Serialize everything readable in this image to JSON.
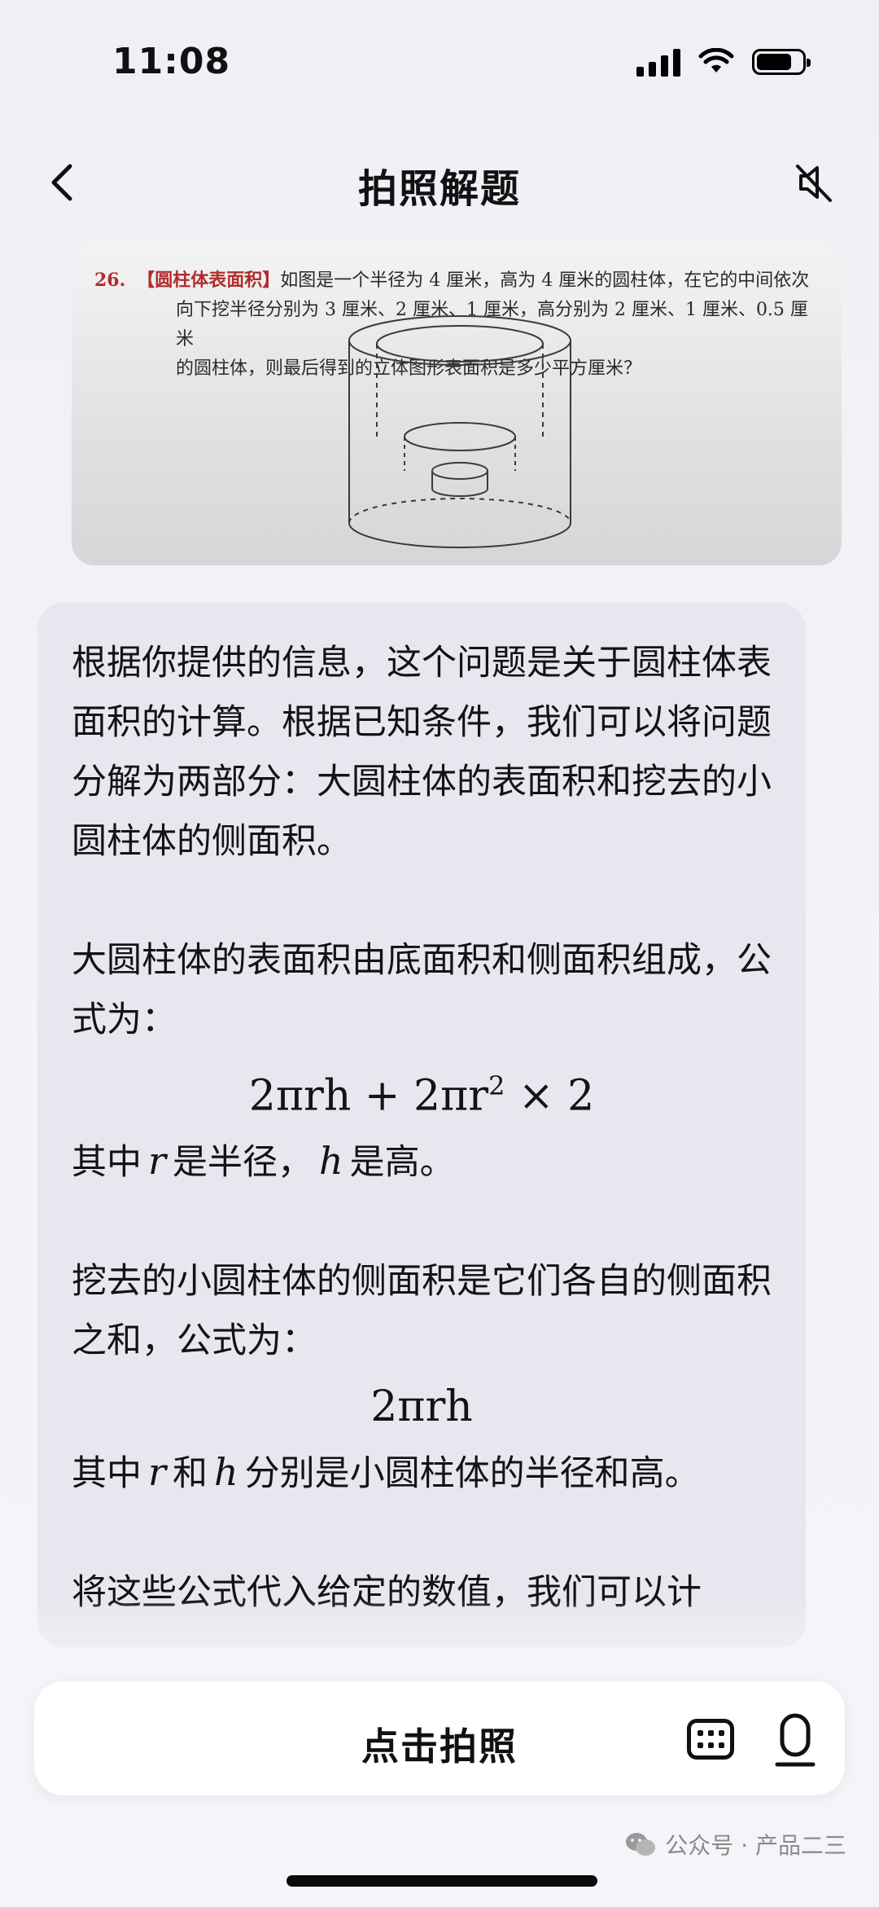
{
  "status": {
    "time": "11:08"
  },
  "nav": {
    "title": "拍照解题"
  },
  "photo": {
    "number": "26.",
    "tag": "【圆柱体表面积】",
    "line1": "如图是一个半径为 4 厘米，高为 4 厘米的圆柱体，在它的中间依次",
    "line2": "向下挖半径分别为 3 厘米、2 厘米、1 厘米，高分别为 2 厘米、1 厘米、0.5 厘米",
    "line3": "的圆柱体，则最后得到的立体图形表面积是多少平方厘米？"
  },
  "answer": {
    "p1": "根据你提供的信息，这个问题是关于圆柱体表面积的计算。根据已知条件，我们可以将问题分解为两部分：大圆柱体的表面积和挖去的小圆柱体的侧面积。",
    "p2": "大圆柱体的表面积由底面积和侧面积组成，公式为：",
    "f1_main": "2πrh + 2πr",
    "f1_sup": "2",
    "f1_tail": " × 2",
    "p3_a": "其中",
    "p3_r": "r",
    "p3_b": "是半径，",
    "p3_h": "h",
    "p3_c": "是高。",
    "p4": "挖去的小圆柱体的侧面积是它们各自的侧面积之和，公式为：",
    "f2": "2πrh",
    "p5_a": "其中",
    "p5_r": "r",
    "p5_b": "和",
    "p5_h": "h",
    "p5_c": "分别是小圆柱体的半径和高。",
    "p6": "将这些公式代入给定的数值，我们可以计"
  },
  "bottom": {
    "snap_label": "点击拍照"
  },
  "watermark": {
    "text": "公众号 · 产品二三"
  },
  "icons": {
    "back": "chevron-left-icon",
    "mute": "speaker-muted-icon",
    "keyboard": "keyboard-icon",
    "mic": "microphone-icon",
    "wechat": "wechat-icon"
  }
}
